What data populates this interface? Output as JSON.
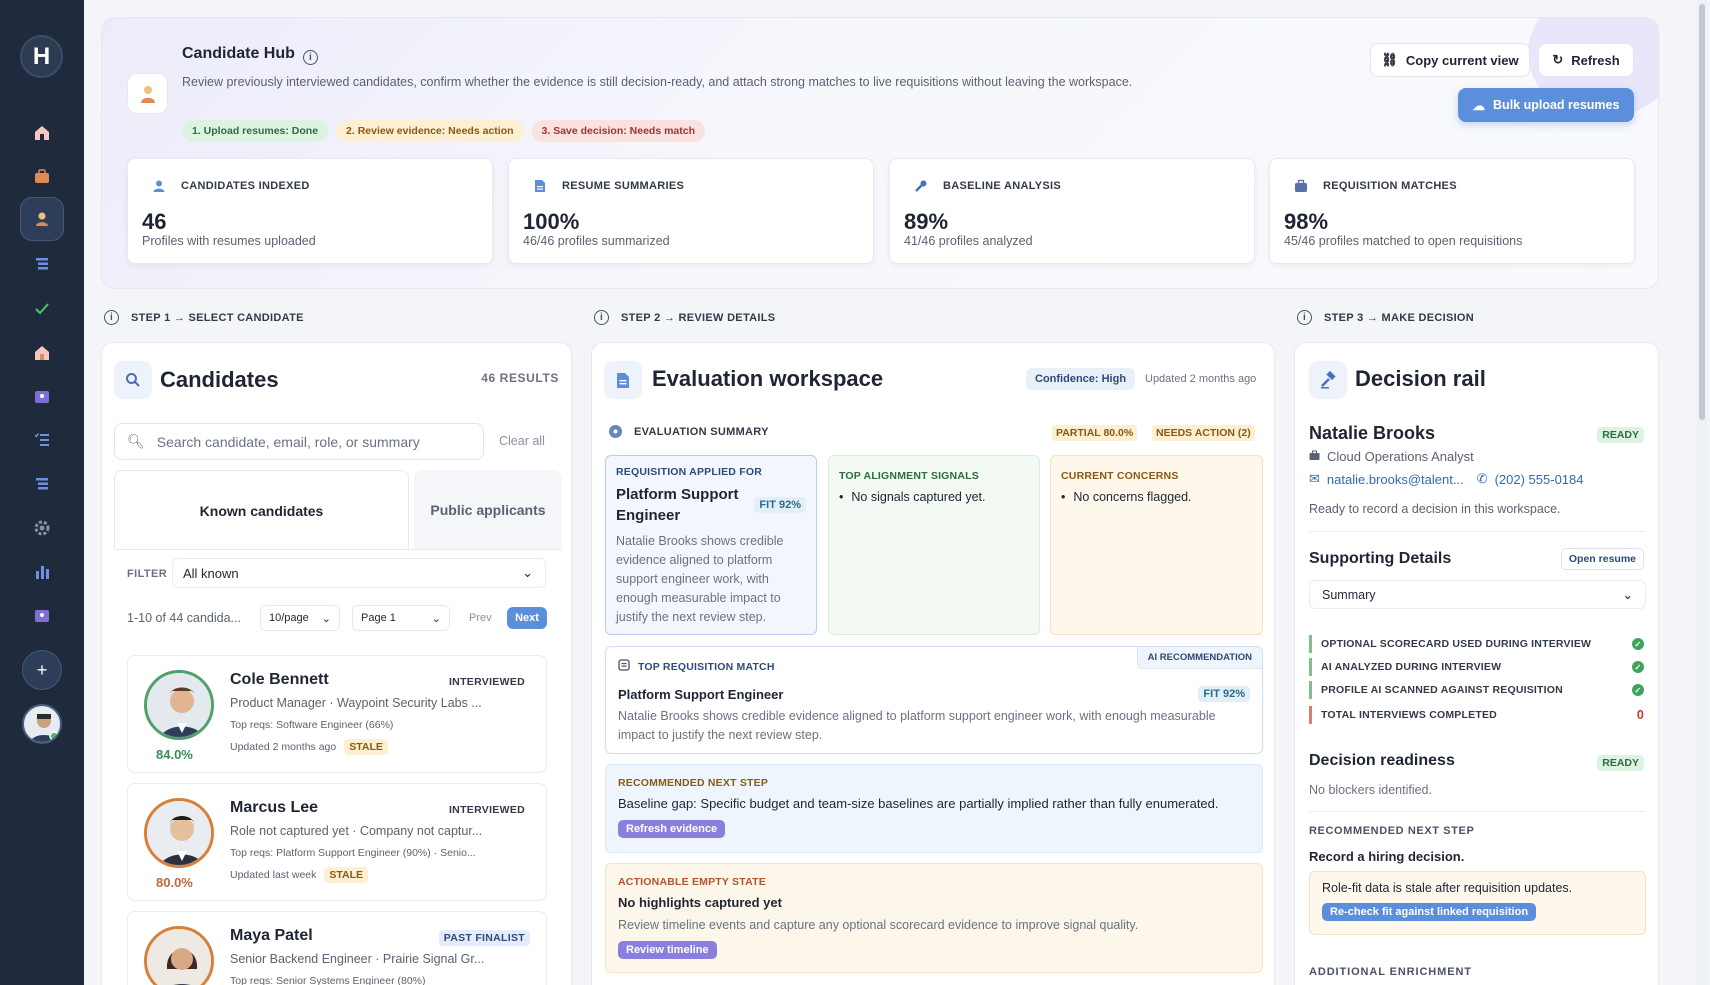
{
  "app": {
    "logo_letter": "H"
  },
  "hero": {
    "title": "Candidate Hub",
    "description": "Review previously interviewed candidates, confirm whether the evidence is still decision-ready, and attach strong matches to live requisitions without leaving the workspace.",
    "steps": [
      "1. Upload resumes: Done",
      "2. Review evidence: Needs action",
      "3. Save decision: Needs match"
    ],
    "copy_view": "Copy current view",
    "refresh": "Refresh",
    "bulk_upload": "Bulk upload resumes"
  },
  "stats": [
    {
      "label": "CANDIDATES INDEXED",
      "value": "46",
      "sub": "Profiles with resumes uploaded",
      "icon": "person-icon"
    },
    {
      "label": "RESUME SUMMARIES",
      "value": "100%",
      "sub": "46/46 profiles summarized",
      "icon": "document-icon"
    },
    {
      "label": "BASELINE ANALYSIS",
      "value": "89%",
      "sub": "41/46 profiles analyzed",
      "icon": "wrench-icon"
    },
    {
      "label": "REQUISITION MATCHES",
      "value": "98%",
      "sub": "45/46 profiles matched to open requisitions",
      "icon": "briefcase-icon"
    }
  ],
  "step_headers": [
    "STEP 1 → SELECT CANDIDATE",
    "STEP 2 → REVIEW DETAILS",
    "STEP 3 → MAKE DECISION"
  ],
  "candidates_panel": {
    "title": "Candidates",
    "results": "46 RESULTS",
    "search_placeholder": "Search candidate, email, role, or summary",
    "clear_all": "Clear all",
    "tabs": [
      "Known candidates",
      "Public applicants"
    ],
    "filter_label": "FILTER",
    "filter_value": "All known",
    "pager_text": "1-10 of 44 candida...",
    "per_page": "10/page",
    "page": "Page 1",
    "prev": "Prev",
    "next": "Next",
    "items": [
      {
        "name": "Cole Bennett",
        "tag": "INTERVIEWED",
        "role": "Product Manager · Waypoint Security Labs ...",
        "reqs": "Top reqs: Software Engineer (66%)",
        "updated": "Updated 2 months ago",
        "stale": "STALE",
        "score": "84.0%"
      },
      {
        "name": "Marcus Lee",
        "tag": "INTERVIEWED",
        "role": "Role not captured yet · Company not captur...",
        "reqs": "Top reqs: Platform Support Engineer (90%) · Senio...",
        "updated": "Updated last week",
        "stale": "STALE",
        "score": "80.0%"
      },
      {
        "name": "Maya Patel",
        "tag": "PAST FINALIST",
        "role": "Senior Backend Engineer · Prairie Signal Gr...",
        "reqs": "Top reqs: Senior Systems Engineer (80%)",
        "updated": "",
        "stale": "",
        "score": ""
      }
    ]
  },
  "eval_panel": {
    "title": "Evaluation workspace",
    "confidence": "Confidence: High",
    "updated": "Updated 2 months ago",
    "summary_label": "EVALUATION SUMMARY",
    "partial": "PARTIAL 80.0%",
    "needs_action": "NEEDS ACTION (2)",
    "req_card": {
      "label": "REQUISITION APPLIED FOR",
      "title": "Platform Support Engineer",
      "fit": "FIT 92%",
      "body": "Natalie Brooks shows credible evidence aligned to platform support engineer work, with enough measurable impact to justify the next review step."
    },
    "signals_card": {
      "label": "TOP ALIGNMENT SIGNALS",
      "item": "No signals captured yet."
    },
    "concerns_card": {
      "label": "CURRENT CONCERNS",
      "item": "No concerns flagged."
    },
    "top_match": {
      "label": "TOP REQUISITION MATCH",
      "ai_tag": "AI RECOMMENDATION",
      "title": "Platform Support Engineer",
      "fit": "FIT 92%",
      "body": "Natalie Brooks shows credible evidence aligned to platform support engineer work, with enough measurable impact to justify the next review step."
    },
    "next_step": {
      "label": "RECOMMENDED NEXT STEP",
      "body": "Baseline gap: Specific budget and team-size baselines are partially implied rather than fully enumerated.",
      "button": "Refresh evidence"
    },
    "empty_state": {
      "label": "ACTIONABLE EMPTY STATE",
      "title": "No highlights captured yet",
      "body": "Review timeline events and capture any optional scorecard evidence to improve signal quality.",
      "button": "Review timeline"
    }
  },
  "decision_panel": {
    "title": "Decision rail",
    "name": "Natalie Brooks",
    "ready": "READY",
    "role": "Cloud Operations Analyst",
    "email": "natalie.brooks@talent...",
    "phone": "(202) 555-0184",
    "status": "Ready to record a decision in this workspace.",
    "supporting_title": "Supporting Details",
    "open_resume": "Open resume",
    "summary_select": "Summary",
    "checks": [
      {
        "label": "OPTIONAL SCORECARD USED DURING INTERVIEW",
        "value": "check"
      },
      {
        "label": "AI ANALYZED DURING INTERVIEW",
        "value": "check"
      },
      {
        "label": "PROFILE AI SCANNED AGAINST REQUISITION",
        "value": "check"
      },
      {
        "label": "TOTAL INTERVIEWS COMPLETED",
        "value": "0"
      }
    ],
    "readiness_title": "Decision readiness",
    "readiness_badge": "READY",
    "blockers": "No blockers identified.",
    "next_step_label": "RECOMMENDED NEXT STEP",
    "next_step_text": "Record a hiring decision.",
    "stale_note": "Role-fit data is stale after requisition updates.",
    "recheck": "Re-check fit against linked requisition",
    "additional": "ADDITIONAL ENRICHMENT"
  }
}
